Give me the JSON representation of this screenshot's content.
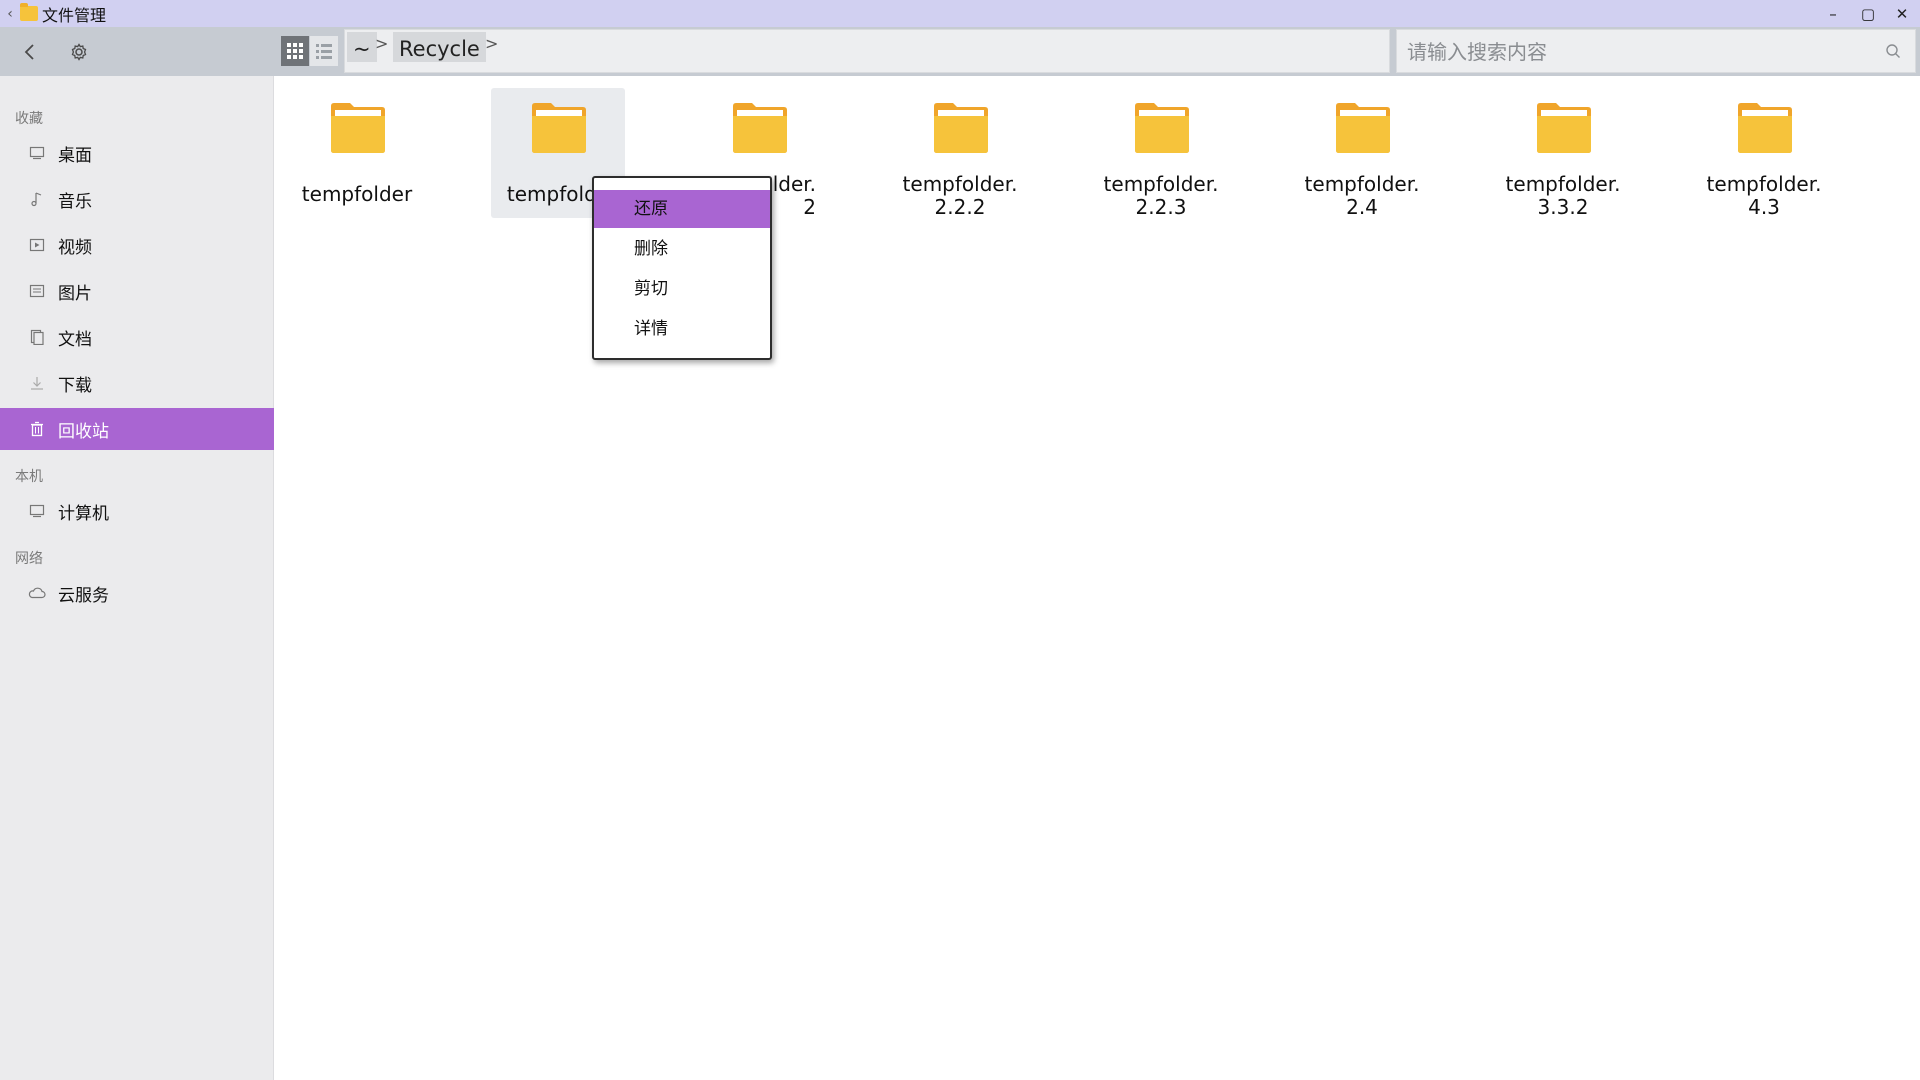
{
  "window": {
    "title": "文件管理",
    "back_glyph": "‹",
    "controls": {
      "minimize": "–",
      "maximize": "▢",
      "close": "✕"
    }
  },
  "toolbar": {
    "back_icon": "chevron-left-icon",
    "settings_icon": "gear-icon",
    "view_modes": [
      "grid-view-icon",
      "list-view-icon"
    ],
    "active_view": "grid"
  },
  "breadcrumb": {
    "items": [
      "~",
      "Recycle"
    ],
    "separator": ">"
  },
  "search": {
    "placeholder": "请输入搜索内容",
    "value": ""
  },
  "sidebar": {
    "sections": [
      {
        "title": "收藏",
        "items": [
          {
            "label": "桌面",
            "icon": "desktop-icon"
          },
          {
            "label": "音乐",
            "icon": "music-icon"
          },
          {
            "label": "视频",
            "icon": "video-icon"
          },
          {
            "label": "图片",
            "icon": "image-icon"
          },
          {
            "label": "文档",
            "icon": "document-icon"
          },
          {
            "label": "下载",
            "icon": "download-icon"
          },
          {
            "label": "回收站",
            "icon": "trash-icon",
            "active": true
          }
        ]
      },
      {
        "title": "本机",
        "items": [
          {
            "label": "计算机",
            "icon": "computer-icon"
          }
        ]
      },
      {
        "title": "网络",
        "items": [
          {
            "label": "云服务",
            "icon": "cloud-icon"
          }
        ]
      }
    ]
  },
  "files": [
    {
      "line1": "tempfolder",
      "line2": ""
    },
    {
      "line1": "tempfolde",
      "line2": ""
    },
    {
      "line1": "lder.",
      "line2": "2"
    },
    {
      "line1": "tempfolder.",
      "line2": "2.2.2"
    },
    {
      "line1": "tempfolder.",
      "line2": "2.2.3"
    },
    {
      "line1": "tempfolder.",
      "line2": "2.4"
    },
    {
      "line1": "tempfolder.",
      "line2": "3.3.2"
    },
    {
      "line1": "tempfolder.",
      "line2": "4.3"
    }
  ],
  "context_menu": {
    "items": [
      "还原",
      "删除",
      "剪切",
      "详情"
    ],
    "highlighted": "还原"
  },
  "colors": {
    "accent": "#a965d2",
    "titlebar": "#d1d0f1",
    "toolbar": "#c6cbd2",
    "folder": "#f6c33b",
    "folder_tab": "#f0a52a"
  }
}
